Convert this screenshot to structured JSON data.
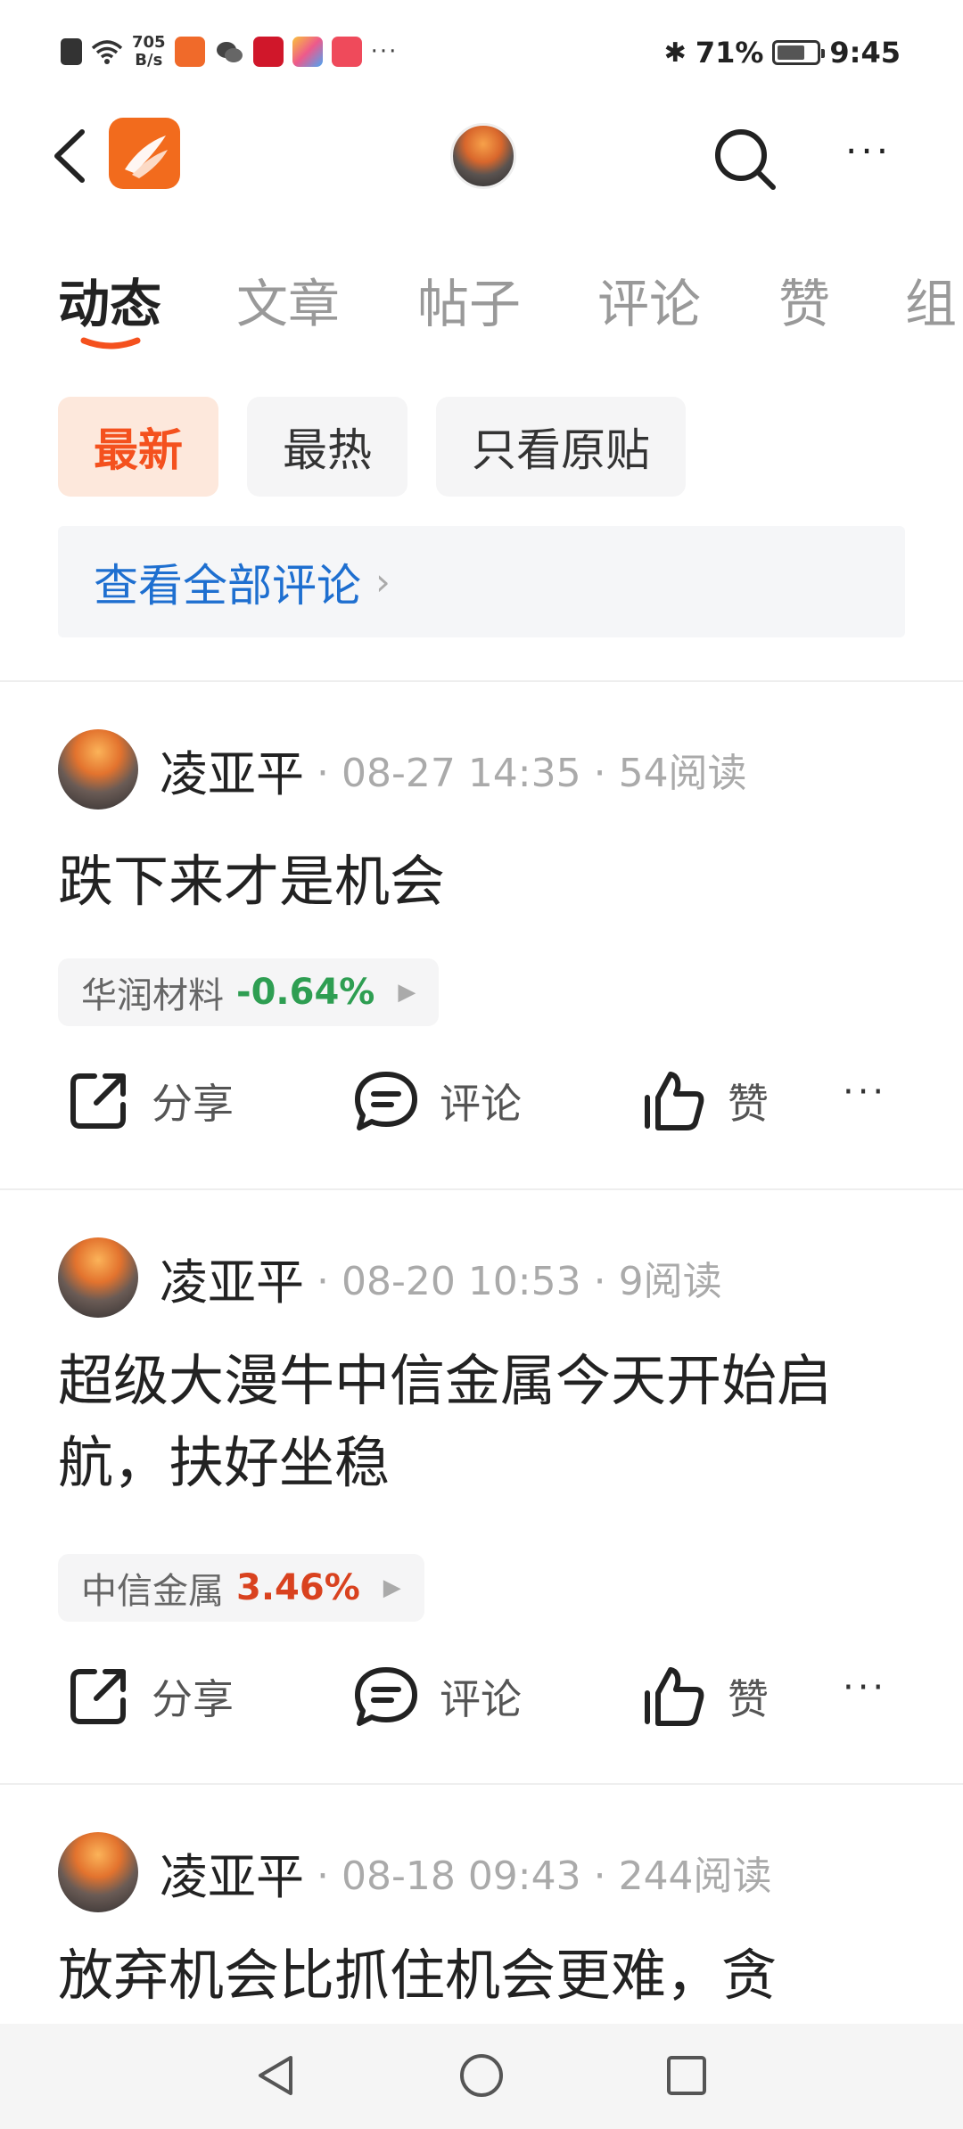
{
  "status_bar": {
    "net_speed_value": "705",
    "net_speed_unit": "B/s",
    "more_notifications": "···",
    "bluetooth": "✱",
    "battery_percent": "71%",
    "battery_level": 0.71,
    "time": "9:45"
  },
  "header": {
    "back_icon": "chevron-left-icon",
    "app_logo": "app-logo",
    "search_icon": "search-icon",
    "more_icon": "···"
  },
  "tabs": [
    {
      "label": "动态",
      "active": true
    },
    {
      "label": "文章",
      "active": false
    },
    {
      "label": "帖子",
      "active": false
    },
    {
      "label": "评论",
      "active": false
    },
    {
      "label": "赞",
      "active": false
    },
    {
      "label": "组",
      "active": false
    }
  ],
  "filters": [
    {
      "label": "最新",
      "active": true
    },
    {
      "label": "最热",
      "active": false
    },
    {
      "label": "只看原贴",
      "active": false
    }
  ],
  "see_all_comments": {
    "label": "查看全部评论",
    "chevron": "›"
  },
  "colors": {
    "accent": "#f4511e",
    "link": "#1e6fd0",
    "down_green": "#2e9e52",
    "up_red": "#d9421f"
  },
  "posts": [
    {
      "author": "凌亚平",
      "meta": "· 08-27 14:35 · 54阅读",
      "title": "跌下来才是机会",
      "stock": {
        "name": "华润材料",
        "change": "-0.64%",
        "direction": "down"
      },
      "actions": {
        "share": "分享",
        "comment": "评论",
        "like": "赞",
        "more": "···"
      }
    },
    {
      "author": "凌亚平",
      "meta": "· 08-20 10:53 · 9阅读",
      "title": "超级大漫牛中信金属今天开始启航，扶好坐稳",
      "stock": {
        "name": "中信金属",
        "change": "3.46%",
        "direction": "up"
      },
      "actions": {
        "share": "分享",
        "comment": "评论",
        "like": "赞",
        "more": "···"
      }
    },
    {
      "author": "凌亚平",
      "meta": "· 08-18 09:43 · 244阅读",
      "title": "放弃机会比抓住机会更难，贪"
    }
  ],
  "nav": {
    "back": "nav-back-icon",
    "home": "nav-home-icon",
    "recent": "nav-recent-icon"
  }
}
